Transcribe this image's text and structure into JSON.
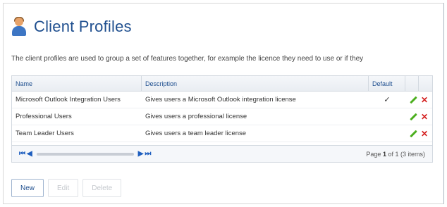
{
  "header": {
    "title": "Client Profiles",
    "icon": "user-profile-icon"
  },
  "description": "The client profiles are used to group a set of features together, for example the licence they need to use or if they",
  "grid": {
    "columns": {
      "name": "Name",
      "description": "Description",
      "default": "Default"
    },
    "rows": [
      {
        "name": "Microsoft Outlook Integration Users",
        "description": "Gives users a Microsoft Outlook integration license",
        "default": "✓"
      },
      {
        "name": "Professional Users",
        "description": "Gives users a professional license",
        "default": ""
      },
      {
        "name": "Team Leader Users",
        "description": "Gives users a team leader license",
        "default": ""
      }
    ],
    "pager": {
      "page_label": "Page",
      "page": "1",
      "of_label": "of 1 (3 items)"
    }
  },
  "buttons": {
    "new": "New",
    "edit": "Edit",
    "delete": "Delete"
  },
  "colors": {
    "title": "#1f4f8f",
    "edit_icon": "#4caf1f",
    "delete_icon": "#d42020",
    "pager_nav": "#1f5fbf"
  }
}
